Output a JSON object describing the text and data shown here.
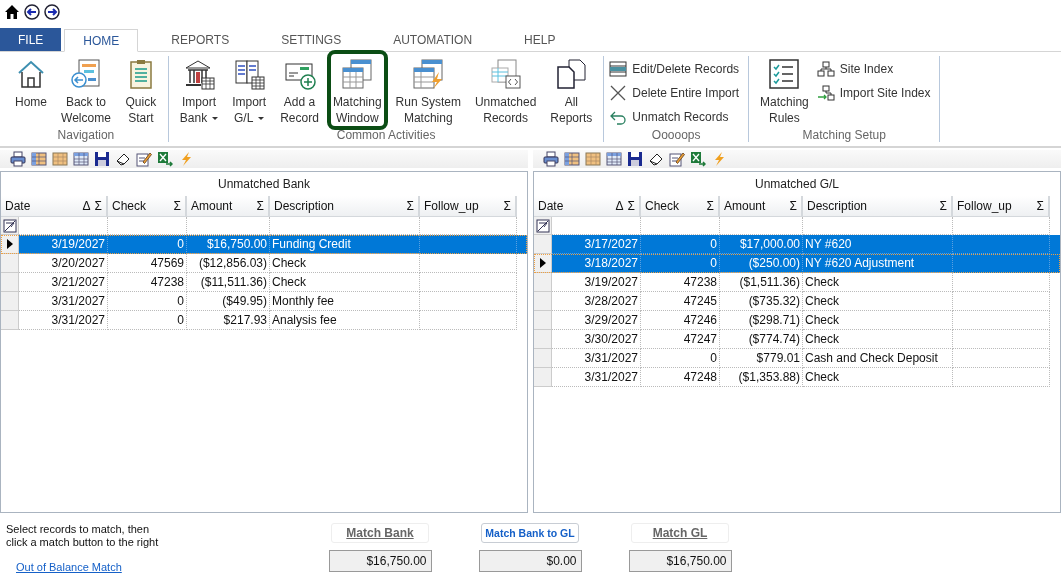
{
  "tabs": [
    {
      "label": "FILE",
      "kind": "file",
      "selected": false
    },
    {
      "label": "HOME",
      "kind": "tab",
      "selected": true
    },
    {
      "label": "REPORTS",
      "kind": "tab",
      "selected": false
    },
    {
      "label": "SETTINGS",
      "kind": "tab",
      "selected": false
    },
    {
      "label": "AUTOMATION",
      "kind": "tab",
      "selected": false
    },
    {
      "label": "HELP",
      "kind": "tab",
      "selected": false
    }
  ],
  "ribbon": {
    "groups": [
      {
        "label": "Navigation",
        "items": [
          {
            "kind": "large",
            "lines": [
              "Home"
            ]
          },
          {
            "kind": "large",
            "lines": [
              "Back to",
              "Welcome"
            ]
          },
          {
            "kind": "large",
            "lines": [
              "Quick",
              "Start"
            ]
          }
        ]
      },
      {
        "label": "Common Activities",
        "items": [
          {
            "kind": "large",
            "lines": [
              "Import",
              "Bank"
            ],
            "dropdown": true
          },
          {
            "kind": "large",
            "lines": [
              "Import",
              "G/L"
            ],
            "dropdown": true
          },
          {
            "kind": "large",
            "lines": [
              "Add a",
              "Record"
            ]
          },
          {
            "kind": "large",
            "lines": [
              "Matching",
              "Window"
            ],
            "highlighted": true
          },
          {
            "kind": "large",
            "lines": [
              "Run System",
              "Matching"
            ]
          },
          {
            "kind": "large",
            "lines": [
              "Unmatched",
              "Records"
            ]
          },
          {
            "kind": "large",
            "lines": [
              "All",
              "Reports"
            ]
          }
        ]
      },
      {
        "label": "Ooooops",
        "items": [
          {
            "kind": "small",
            "lines": [
              "Edit/Delete Records"
            ]
          },
          {
            "kind": "small",
            "lines": [
              "Delete Entire Import"
            ]
          },
          {
            "kind": "small",
            "lines": [
              "Unmatch Records"
            ]
          }
        ]
      },
      {
        "label": "Matching Setup",
        "items": [
          {
            "kind": "large",
            "lines": [
              "Matching",
              "Rules"
            ]
          },
          {
            "kind": "small",
            "lines": [
              "Site Index"
            ]
          },
          {
            "kind": "small",
            "lines": [
              "Import Site Index"
            ]
          }
        ]
      }
    ]
  },
  "grids": [
    {
      "title": "Unmatched Bank",
      "columns": [
        {
          "label": "Date",
          "sort_mark": "Δ",
          "sum_mark": "Σ"
        },
        {
          "label": "Check",
          "sum_mark": "Σ"
        },
        {
          "label": "Amount",
          "sum_mark": "Σ"
        },
        {
          "label": "Description",
          "sum_mark": "Σ"
        },
        {
          "label": "Follow_up",
          "sum_mark": "Σ"
        }
      ],
      "rows": [
        {
          "cells": [
            "3/19/2027",
            "0",
            "$16,750.00",
            "Funding Credit"
          ],
          "selected": true,
          "current": true
        },
        {
          "cells": [
            "3/20/2027",
            "47569",
            "($12,856.03)",
            "Check"
          ],
          "selected": false,
          "current": false
        },
        {
          "cells": [
            "3/21/2027",
            "47238",
            "($11,511.36)",
            "Check"
          ],
          "selected": false,
          "current": false
        },
        {
          "cells": [
            "3/31/2027",
            "0",
            "($49.95)",
            "Monthly fee"
          ],
          "selected": false,
          "current": false
        },
        {
          "cells": [
            "3/31/2027",
            "0",
            "$217.93",
            "Analysis fee"
          ],
          "selected": false,
          "current": false
        }
      ]
    },
    {
      "title": "Unmatched G/L",
      "columns": [
        {
          "label": "Date",
          "sort_mark": "Δ",
          "sum_mark": "Σ"
        },
        {
          "label": "Check",
          "sum_mark": "Σ"
        },
        {
          "label": "Amount",
          "sum_mark": "Σ"
        },
        {
          "label": "Description",
          "sum_mark": "Σ"
        },
        {
          "label": "Follow_up",
          "sum_mark": "Σ"
        }
      ],
      "rows": [
        {
          "cells": [
            "3/17/2027",
            "0",
            "$17,000.00",
            "NY #620"
          ],
          "selected": true,
          "current": false
        },
        {
          "cells": [
            "3/18/2027",
            "0",
            "($250.00)",
            "NY #620 Adjustment"
          ],
          "selected": true,
          "current": true
        },
        {
          "cells": [
            "3/19/2027",
            "47238",
            "($1,511.36)",
            "Check"
          ],
          "selected": false,
          "current": false
        },
        {
          "cells": [
            "3/28/2027",
            "47245",
            "($735.32)",
            "Check"
          ],
          "selected": false,
          "current": false
        },
        {
          "cells": [
            "3/29/2027",
            "47246",
            "($298.71)",
            "Check"
          ],
          "selected": false,
          "current": false
        },
        {
          "cells": [
            "3/30/2027",
            "47247",
            "($774.74)",
            "Check"
          ],
          "selected": false,
          "current": false
        },
        {
          "cells": [
            "3/31/2027",
            "0",
            "$779.01",
            "Cash and Check Deposit"
          ],
          "selected": false,
          "current": false
        },
        {
          "cells": [
            "3/31/2027",
            "47248",
            "($1,353.88)",
            "Check"
          ],
          "selected": false,
          "current": false
        }
      ]
    }
  ],
  "footer": {
    "instructions": "Select records to match, then click a match button to the right",
    "link": "Out of Balance Match",
    "matches": [
      {
        "label": "Match Bank",
        "enabled": false,
        "value": "$16,750.00"
      },
      {
        "label": "Match Bank to GL",
        "enabled": true,
        "value": "$0.00"
      },
      {
        "label": "Match GL",
        "enabled": false,
        "value": "$16,750.00"
      }
    ]
  }
}
